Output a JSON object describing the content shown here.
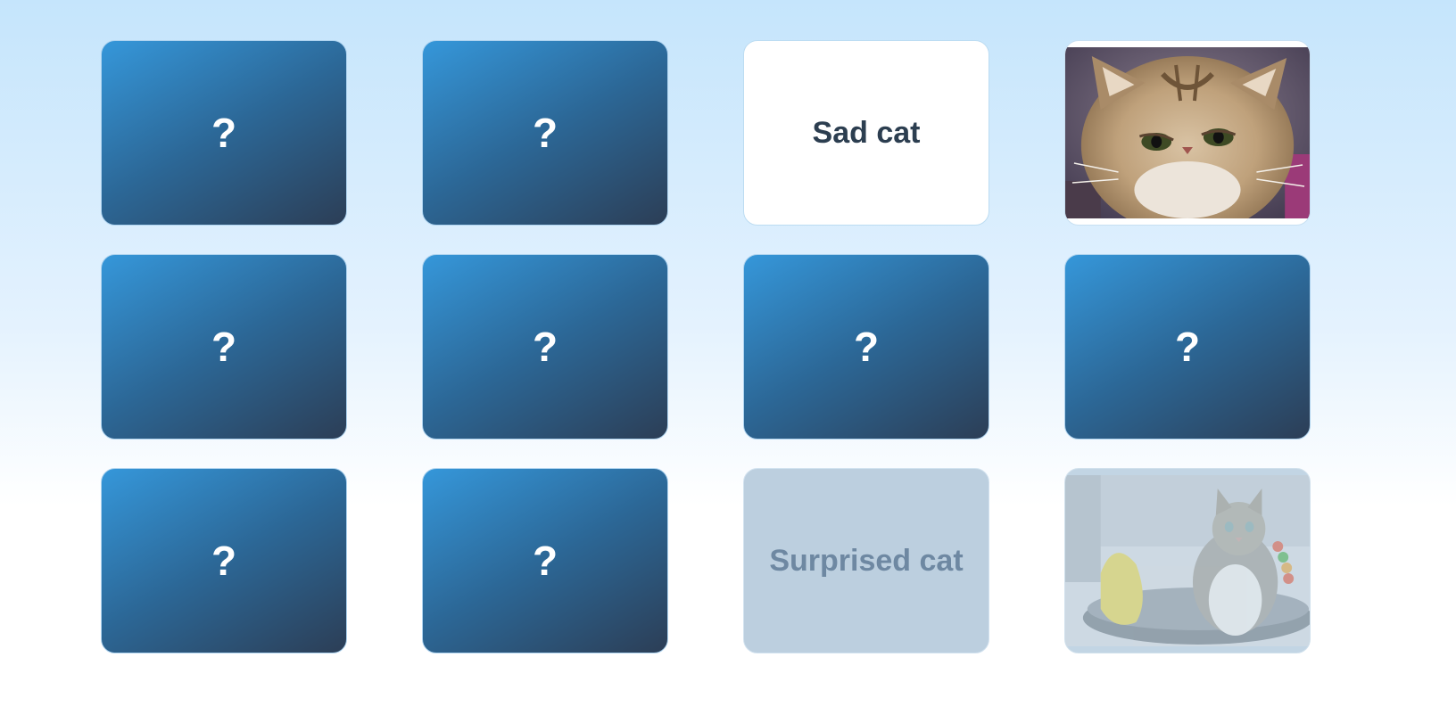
{
  "board": {
    "back_mark": "?",
    "cards": [
      {
        "state": "hidden",
        "mark": "?"
      },
      {
        "state": "hidden",
        "mark": "?"
      },
      {
        "state": "revealed-text",
        "label": "Sad cat"
      },
      {
        "state": "revealed-image",
        "image": "sad-persian-cat-photo"
      },
      {
        "state": "hidden",
        "mark": "?"
      },
      {
        "state": "hidden",
        "mark": "?"
      },
      {
        "state": "hidden",
        "mark": "?"
      },
      {
        "state": "hidden",
        "mark": "?"
      },
      {
        "state": "hidden",
        "mark": "?"
      },
      {
        "state": "hidden",
        "mark": "?"
      },
      {
        "state": "matched-text",
        "label": "Surprised cat"
      },
      {
        "state": "matched-image",
        "image": "surprised-tabby-cat-photo"
      }
    ]
  },
  "colors": {
    "card_back_start": "#3597da",
    "card_back_end": "#2c3e56",
    "face_text": "#2c3e50",
    "matched_bg": "#bccfdf",
    "matched_text": "#6e88a2"
  }
}
